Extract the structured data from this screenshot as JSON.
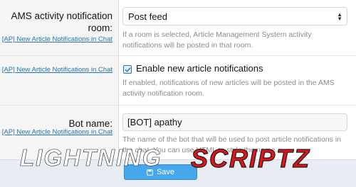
{
  "fields": {
    "room": {
      "label": "AMS activity notification room:",
      "link": "[AP] New Article Notifications in Chat",
      "selected": "Post feed",
      "explain": "If a room is selected, Article Management System activity notifications will be posted in that room."
    },
    "enable": {
      "link": "[AP] New Article Notifications in Chat",
      "checkbox_label": "Enable new article notifications",
      "checked": true,
      "explain": "If enabled, notifications of new articles will be posted in the AMS activity notification room."
    },
    "botname": {
      "label": "Bot name:",
      "link": "[AP] New Article Notifications in Chat",
      "value": "[BOT] apathy",
      "explain": "The name of the bot that will be used to post article notifications in the chat. You can use HTML to style the name."
    }
  },
  "save_label": "Save",
  "watermark": {
    "word1": "LIGHTNING",
    "word2": "SCRIPTZ"
  },
  "colors": {
    "accent": "#47a7eb",
    "link": "#2577b1",
    "watermark_red": "#e0141c"
  }
}
